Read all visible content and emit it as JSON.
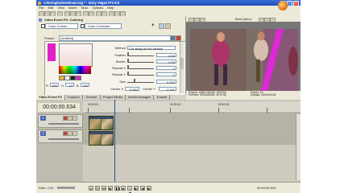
{
  "window": {
    "title": "coloring51download.veg * - Sony Vegas Pro 8.0"
  },
  "menu": [
    "File",
    "Edit",
    "View",
    "Insert",
    "Tools",
    "Options",
    "Help"
  ],
  "fx_panel": {
    "title": "Video Event FX: Coloring",
    "chain": [
      {
        "label": "Color Curves"
      },
      {
        "label": "Color Corrector"
      }
    ],
    "preset_label": "Preset:",
    "preset_value": "(Untitled)",
    "rgb": [
      {
        "label": "R",
        "value": "255"
      },
      {
        "label": "G",
        "value": "12"
      },
      {
        "label": "B",
        "value": "226"
      }
    ],
    "method": {
      "label": "Method",
      "value": "Cut away all but section"
    },
    "params": [
      {
        "label": "Feather",
        "value": "0.00"
      },
      {
        "label": "Border",
        "value": "0.00"
      },
      {
        "label": "Repeat X",
        "value": "1"
      },
      {
        "label": "Repeat Y",
        "value": "1"
      },
      {
        "label": "Size",
        "value": "0.200"
      },
      {
        "label": "Center X",
        "value": "0.252"
      },
      {
        "label": "Center Y",
        "value": "0.411"
      }
    ]
  },
  "preview": {
    "dropdown": "Best (Auto)",
    "project_label": "Project:",
    "project_value": "1280x720x32, 29.970p",
    "preview_label": "Preview:",
    "preview_value": "320x180x32, 29.970p",
    "display_label": "Display:",
    "display_value": "430x242x32",
    "frame_label": "Frame:",
    "frame_value": "19"
  },
  "tabs": [
    "Video Event FX",
    "Explorer",
    "Trimmer",
    "Project Media",
    "Media Manager",
    "Transiti"
  ],
  "timeline": {
    "timecode": "00:00:00.634",
    "ruler_labels": [
      "00:00:00",
      "00:00:10",
      "00:00:15"
    ],
    "tracks": [
      {
        "number": "1"
      },
      {
        "number": "2"
      }
    ],
    "rate_label": "Rate: 0.00",
    "end_timecode": "00:00:00.634"
  },
  "colors": {
    "mask_magenta": "#e020c8",
    "title_blue": "#1d4fb8",
    "panel_bg": "#ece9d8"
  }
}
